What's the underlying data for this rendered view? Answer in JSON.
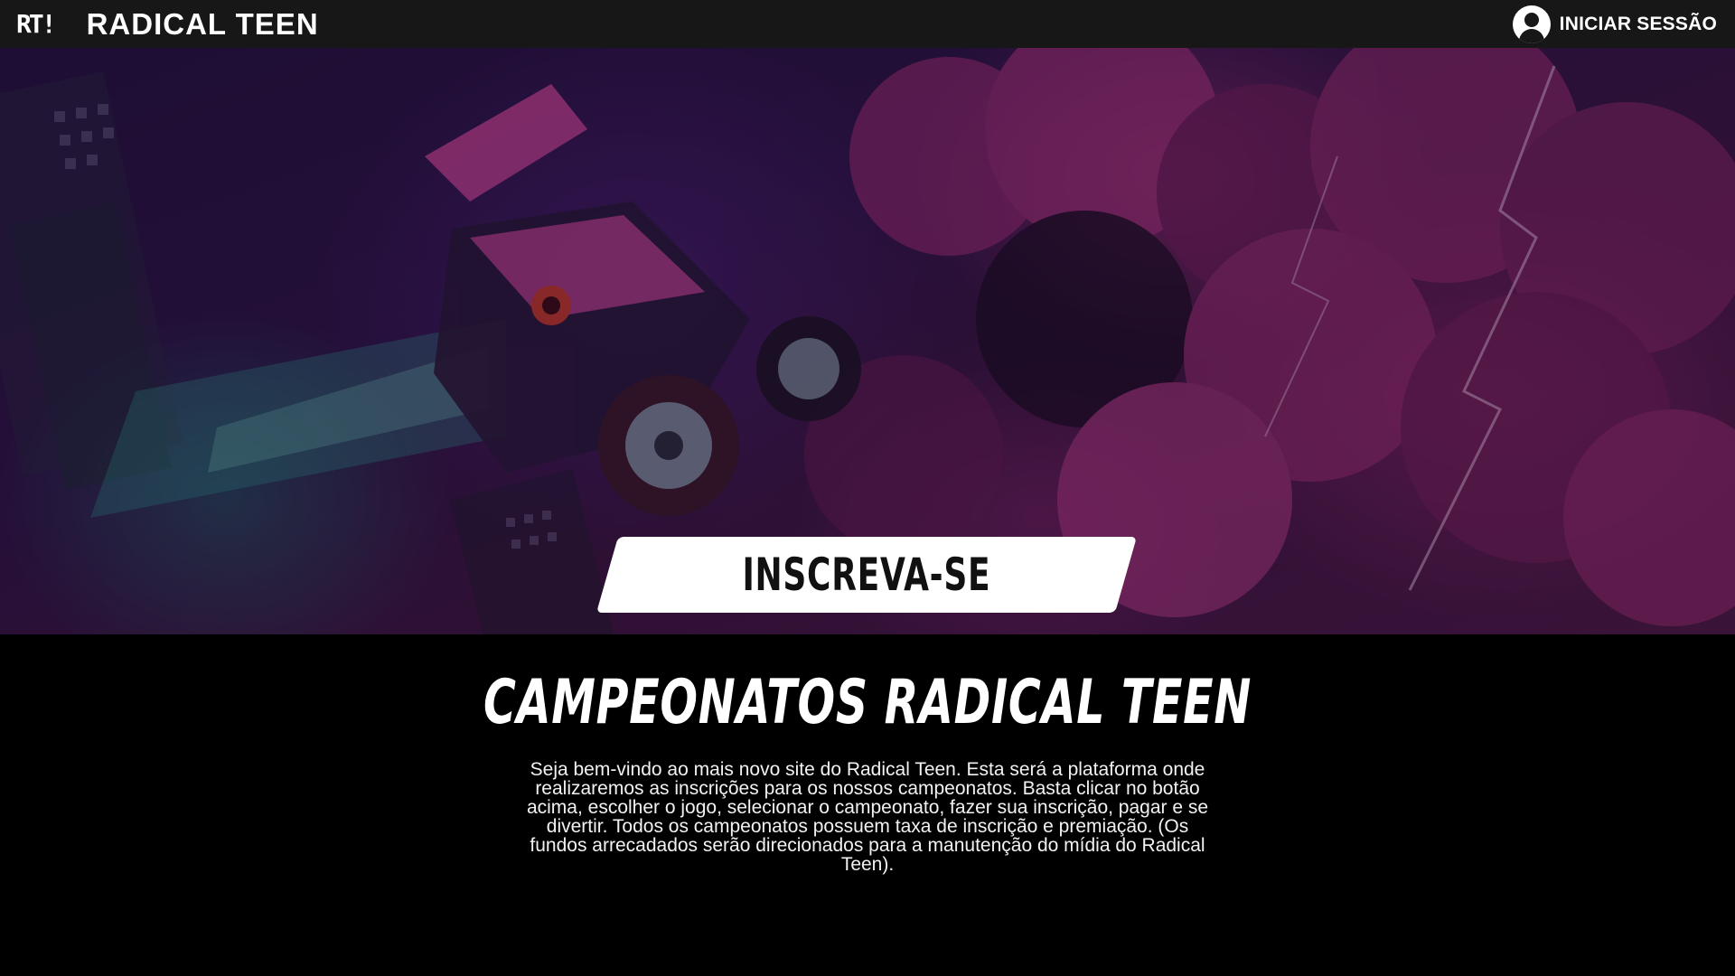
{
  "header": {
    "brand_mark": "RT!",
    "brand_name": "RADICAL TEEN",
    "login_icon": "user-circle-icon",
    "login_label": "INICIAR SESSÃO"
  },
  "hero": {
    "cta_label": "INSCREVA-SE"
  },
  "content": {
    "title": "CAMPEONATOS RADICAL TEEN",
    "body": "Seja bem-vindo ao mais novo site do Radical Teen. Esta será a plataforma onde realizaremos as inscrições para os nossos campeonatos. Basta clicar no botão acima, escolher o jogo, selecionar o campeonato, fazer sua inscrição, pagar e se divertir. Todos os campeonatos possuem taxa de inscrição e premiação. (Os fundos arrecadados serão direcionados para a manutenção do mídia do Radical Teen)."
  },
  "colors": {
    "header_bg": "#171717",
    "page_bg": "#000000",
    "cta_bg": "#ffffff",
    "text": "#ffffff"
  }
}
